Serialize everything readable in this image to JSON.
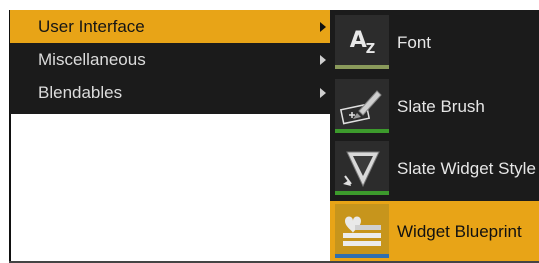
{
  "menu": {
    "items": [
      {
        "label": "User Interface",
        "active": true
      },
      {
        "label": "Miscellaneous",
        "active": false
      },
      {
        "label": "Blendables",
        "active": false
      }
    ]
  },
  "submenu": {
    "items": [
      {
        "label": "Font",
        "icon": "font-asset-icon",
        "icon_text": "A",
        "icon_sub": "Z",
        "bar_color": "#8a9a5b"
      },
      {
        "label": "Slate Brush",
        "icon": "slate-brush-icon",
        "bar_color": "#3c9a2c"
      },
      {
        "label": "Slate Widget Style",
        "icon": "slate-widget-style-icon",
        "bar_color": "#3c9a2c"
      },
      {
        "label": "Widget Blueprint",
        "icon": "widget-blueprint-icon",
        "bar_color": "#2f6fb0",
        "active": true
      }
    ]
  },
  "colors": {
    "highlight": "#e8a417",
    "menu_bg": "#1b1b1b",
    "text": "#dcdcdc"
  }
}
